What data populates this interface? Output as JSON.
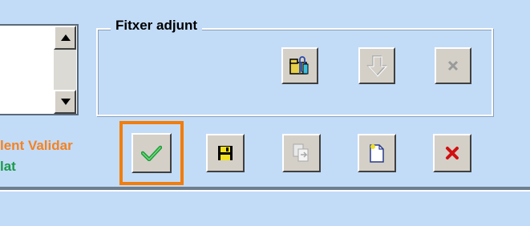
{
  "attachment_group": {
    "legend": "Fitxer adjunt"
  },
  "status": {
    "line1": "lent Validar",
    "line2": "lat",
    "line1_color": "#f58220",
    "line2_color": "#1a9a4a"
  },
  "icons": {
    "attach": "paperclip-folder-icon",
    "download": "down-arrow-icon",
    "delete_attachment": "x-icon",
    "validate": "checkmark-icon",
    "save": "floppy-disk-icon",
    "transfer": "document-transfer-icon",
    "new": "new-document-icon",
    "cancel": "red-x-icon"
  },
  "colors": {
    "background": "#c2dcf8",
    "highlight": "#f27d0c",
    "button": "#d4d0c8"
  }
}
